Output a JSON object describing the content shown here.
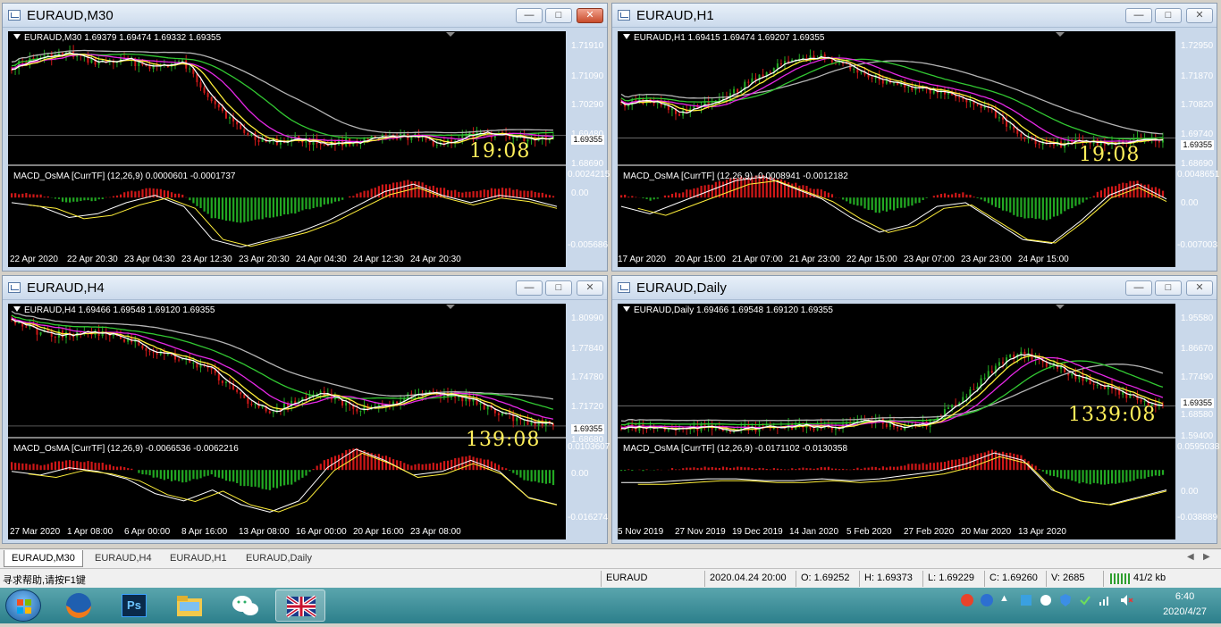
{
  "windows": [
    {
      "id": "m30",
      "title": "EURAUD,M30",
      "info": "EURAUD,M30  1.69379 1.69474 1.69332 1.69355",
      "price_axis": [
        "1.71910",
        "1.71090",
        "1.70290",
        "1.69480",
        "1.68690"
      ],
      "price_tag": "1.69355",
      "timer": "19:08",
      "macd_label": "MACD_OsMA [CurrTF] (12,26,9) 0.0000601 -0.0001737",
      "macd_axis": [
        "0.0024215",
        "0.00",
        "-0.005686"
      ],
      "time_axis": [
        "22 Apr 2020",
        "22 Apr 20:30",
        "23 Apr 04:30",
        "23 Apr 12:30",
        "23 Apr 20:30",
        "24 Apr 04:30",
        "24 Apr 12:30",
        "24 Apr 20:30"
      ]
    },
    {
      "id": "h1",
      "title": "EURAUD,H1",
      "info": "EURAUD,H1  1.69415 1.69474 1.69207 1.69355",
      "price_axis": [
        "1.72950",
        "1.71870",
        "1.70820",
        "1.69740",
        "1.68690"
      ],
      "price_tag": "1.69355",
      "timer": "19:08",
      "macd_label": "MACD_OsMA [CurrTF] (12,26,9) -0.0008941 -0.0012182",
      "macd_axis": [
        "0.0048651",
        "0.00",
        "-0.007003"
      ],
      "time_axis": [
        "17 Apr 2020",
        "20 Apr 15:00",
        "21 Apr 07:00",
        "21 Apr 23:00",
        "22 Apr 15:00",
        "23 Apr 07:00",
        "23 Apr 23:00",
        "24 Apr 15:00"
      ]
    },
    {
      "id": "h4",
      "title": "EURAUD,H4",
      "info": "EURAUD,H4  1.69466 1.69548 1.69120 1.69355",
      "price_axis": [
        "1.80990",
        "1.77840",
        "1.74780",
        "1.71720",
        "1.68680"
      ],
      "price_tag": "1.69355",
      "timer": "139:08",
      "macd_label": "MACD_OsMA [CurrTF] (12,26,9) -0.0066536 -0.0062216",
      "macd_axis": [
        "0.0103607",
        "0.00",
        "-0.016274"
      ],
      "time_axis": [
        "27 Mar 2020",
        "1 Apr 08:00",
        "6 Apr 00:00",
        "8 Apr 16:00",
        "13 Apr 08:00",
        "16 Apr 00:00",
        "20 Apr 16:00",
        "23 Apr 08:00"
      ]
    },
    {
      "id": "daily",
      "title": "EURAUD,Daily",
      "info": "EURAUD,Daily  1.69466 1.69548 1.69120 1.69355",
      "price_axis": [
        "1.95580",
        "1.86670",
        "1.77490",
        "1.68580",
        "1.59400"
      ],
      "price_tag": "1.69355",
      "timer": "1339:08",
      "macd_label": "MACD_OsMA [CurrTF] (12,26,9) -0.0171102 -0.0130358",
      "macd_axis": [
        "0.0595038",
        "0.00",
        "-0.038889"
      ],
      "time_axis": [
        "5 Nov 2019",
        "27 Nov 2019",
        "19 Dec 2019",
        "14 Jan 2020",
        "5 Feb 2020",
        "27 Feb 2020",
        "20 Mar 2020",
        "13 Apr 2020"
      ]
    }
  ],
  "tabs": [
    "EURAUD,M30",
    "EURAUD,H4",
    "EURAUD,H1",
    "EURAUD,Daily"
  ],
  "status": {
    "help": "寻求帮助,请按F1键",
    "symbol": "EURAUD",
    "datetime": "2020.04.24 20:00",
    "open": "O: 1.69252",
    "high": "H: 1.69373",
    "low": "L: 1.69229",
    "close": "C: 1.69260",
    "volume": "V: 2685",
    "traffic": "41/2 kb"
  },
  "taskbar": {
    "apps": [
      "start-orb",
      "firefox",
      "photoshop",
      "file-explorer",
      "wechat",
      "metatrader"
    ],
    "ps_label": "Ps",
    "time": "6:40",
    "date": "2020/4/27"
  },
  "colors": {
    "bull": "#22a822",
    "bear": "#d01818",
    "ma_fast": "#ffffff",
    "ma_yellow": "#ffef3a",
    "ma_magenta": "#e628e6",
    "ma_green": "#32c832",
    "ma_gray": "#b4b4b4",
    "timer": "#ffef5a"
  }
}
